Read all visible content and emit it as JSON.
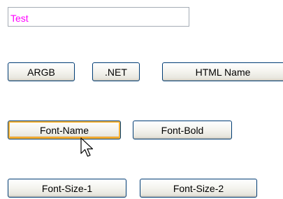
{
  "textbox": {
    "value": "Test",
    "text_color": "#ff00ff"
  },
  "buttons": {
    "argb": "ARGB",
    "net": ".NET",
    "html_name": "HTML Name",
    "font_name": "Font-Name",
    "font_bold": "Font-Bold",
    "font_size_1": "Font-Size-1",
    "font_size_2": "Font-Size-2"
  },
  "hovered_button": "font_name",
  "cursor_icon": "arrow-pointer-icon"
}
